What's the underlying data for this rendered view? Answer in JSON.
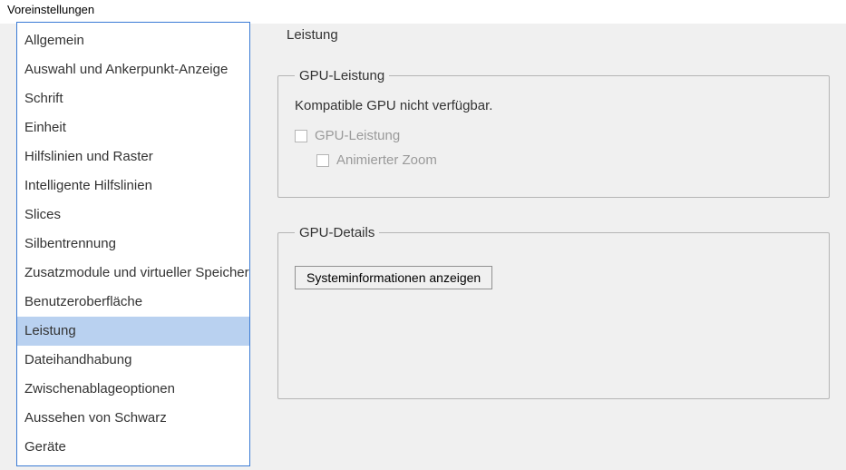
{
  "window": {
    "title": "Voreinstellungen"
  },
  "sidebar": {
    "items": [
      {
        "label": "Allgemein"
      },
      {
        "label": "Auswahl und Ankerpunkt-Anzeige"
      },
      {
        "label": "Schrift"
      },
      {
        "label": "Einheit"
      },
      {
        "label": "Hilfslinien und Raster"
      },
      {
        "label": "Intelligente Hilfslinien"
      },
      {
        "label": "Slices"
      },
      {
        "label": "Silbentrennung"
      },
      {
        "label": "Zusatzmodule und virtueller Speicher"
      },
      {
        "label": "Benutzeroberfläche"
      },
      {
        "label": "Leistung"
      },
      {
        "label": "Dateihandhabung"
      },
      {
        "label": "Zwischenablageoptionen"
      },
      {
        "label": "Aussehen von Schwarz"
      },
      {
        "label": "Geräte"
      }
    ],
    "selectedIndex": 10
  },
  "panel": {
    "title": "Leistung",
    "gpuPerformance": {
      "legend": "GPU-Leistung",
      "status": "Kompatible GPU nicht verfügbar.",
      "checkboxGpu": "GPU-Leistung",
      "checkboxZoom": "Animierter Zoom"
    },
    "gpuDetails": {
      "legend": "GPU-Details",
      "button": "Systeminformationen anzeigen"
    }
  }
}
